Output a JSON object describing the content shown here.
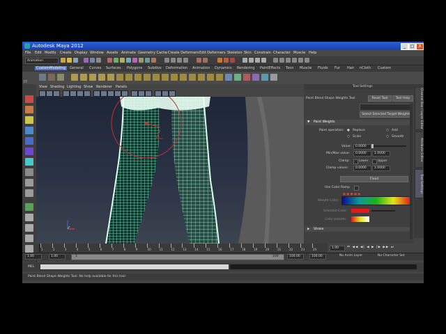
{
  "window": {
    "title": "Autodesk Maya 2012",
    "min": "_",
    "max": "□",
    "close": "X"
  },
  "menus": [
    "File",
    "Edit",
    "Modify",
    "Create",
    "Display",
    "Window",
    "Assets",
    "Animate",
    "Geometry Cache",
    "Create Deformers",
    "Edit Deformers",
    "Skeleton",
    "Skin",
    "Constrain",
    "Character",
    "Muscle",
    "Help"
  ],
  "status": {
    "mode": "Animation"
  },
  "shelf_tabs": [
    "CustomModeling",
    "General",
    "Curves",
    "Surfaces",
    "Polygons",
    "Subdivs",
    "Deformation",
    "Animation",
    "Dynamics",
    "Rendering",
    "PaintEffects",
    "Toon",
    "Muscle",
    "Fluids",
    "Fur",
    "Hair",
    "nCloth",
    "Custom"
  ],
  "toolbox_labels": [
    "FT",
    "ICP",
    "FltM"
  ],
  "viewport_menu": [
    "View",
    "Shading",
    "Lighting",
    "Show",
    "Renderer",
    "Panels"
  ],
  "tool_settings": {
    "header": "Tool Settings",
    "tool_name": "Paint Blend Shape Weights Tool",
    "reset": "Reset Tool",
    "help": "Tool Help",
    "select_targets": "Select Selected Target Weights",
    "section": "Paint Weights",
    "paint_operation_label": "Paint operation:",
    "op_replace": "Replace",
    "op_add": "Add",
    "op_scale": "Scale",
    "op_smooth": "Smooth",
    "value_label": "Value:",
    "value": "0.0000",
    "minmax_label": "Min/Max value:",
    "min": "0.0000",
    "max": "1.0000",
    "clamp_label": "Clamp:",
    "clamp_lower": "Lower",
    "clamp_upper": "Upper",
    "clamp_values_label": "Clamp values:",
    "clamp_min": "0.0000",
    "clamp_max": "1.0000",
    "flood": "Flood",
    "use_color_ramp": "Use Color Ramp",
    "weight_color": "Weight Color:",
    "selected_color": "Selected Color:",
    "color_presets": "Color presets:",
    "stroke": "Stroke"
  },
  "side_tabs": [
    "Channel Box / Layer Editor",
    "Attribute Editor",
    "Tool Settings"
  ],
  "timeline": {
    "ticks": [
      "1",
      "2",
      "3",
      "4",
      "5",
      "6",
      "7",
      "8",
      "9",
      "10",
      "11",
      "12",
      "13",
      "14",
      "15",
      "16",
      "17",
      "18",
      "19",
      "20",
      "21",
      "22",
      "23",
      "24"
    ],
    "current": "1.00"
  },
  "range": {
    "start": "1.00",
    "start2": "1.00",
    "cur": "1",
    "end_field": "100",
    "end1": "100.00",
    "end2": "100.00",
    "anim_layer": "No Anim Layer",
    "char_set": "No Character Set"
  },
  "cmd": {
    "label": "MEL"
  },
  "help_line": "Paint Blend Shape Weights Tool: No help available for this tool"
}
